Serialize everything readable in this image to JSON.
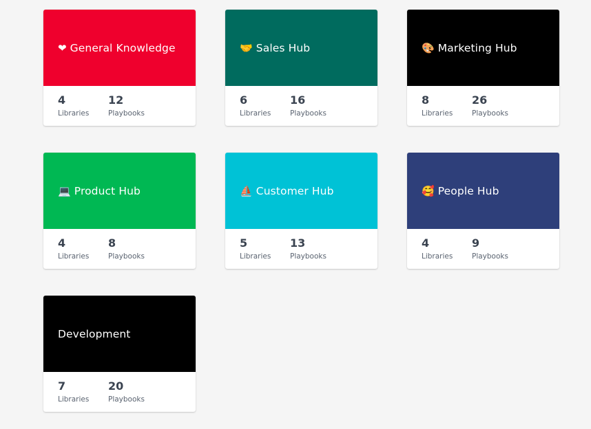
{
  "stat_labels": {
    "libraries": "Libraries",
    "playbooks": "Playbooks"
  },
  "hubs": [
    {
      "title": "General Knowledge",
      "icon": "heart-icon",
      "emoji": "❤",
      "color": "#ef002d",
      "libraries": "4",
      "playbooks": "12"
    },
    {
      "title": "Sales Hub",
      "icon": "handshake-icon",
      "emoji": "🤝",
      "color": "#006b5e",
      "libraries": "6",
      "playbooks": "16"
    },
    {
      "title": "Marketing Hub",
      "icon": "palette-icon",
      "emoji": "🎨",
      "color": "#000000",
      "libraries": "8",
      "playbooks": "26"
    },
    {
      "title": "Product Hub",
      "icon": "laptop-icon",
      "emoji": "💻",
      "color": "#00b853",
      "libraries": "4",
      "playbooks": "8"
    },
    {
      "title": "Customer Hub",
      "icon": "sailboat-icon",
      "emoji": "⛵",
      "color": "#00c2d6",
      "libraries": "5",
      "playbooks": "13"
    },
    {
      "title": "People Hub",
      "icon": "smiling-face-with-hearts-icon",
      "emoji": "🥰",
      "color": "#2e3f7a",
      "libraries": "4",
      "playbooks": "9"
    },
    {
      "title": "Development",
      "icon": "",
      "emoji": "",
      "color": "#000000",
      "libraries": "7",
      "playbooks": "20"
    }
  ]
}
